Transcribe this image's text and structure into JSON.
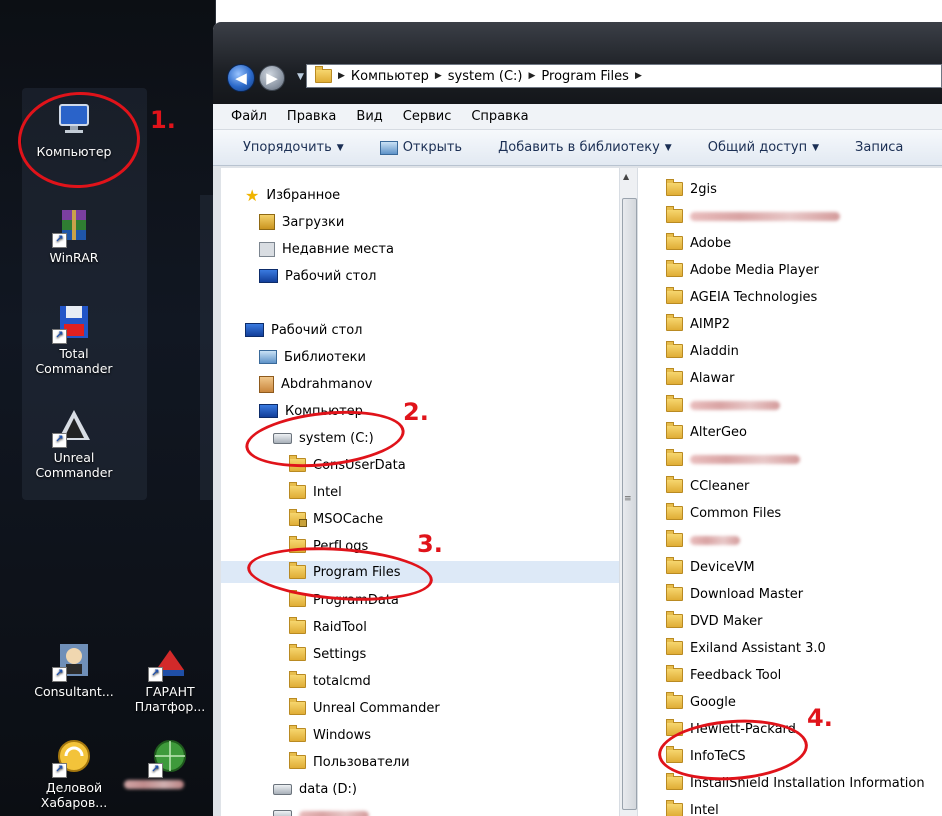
{
  "desktop": {
    "icons": [
      {
        "label": "Компьютер",
        "icon": "computer-icon"
      },
      {
        "label": "WinRAR",
        "icon": "winrar-icon"
      },
      {
        "label": "Total Commander",
        "icon": "total-commander-icon"
      },
      {
        "label": "Unreal Commander",
        "icon": "unreal-commander-icon"
      },
      {
        "label": "Consultant...",
        "icon": "consultant-icon"
      },
      {
        "label": "ГАРАНТ Платфор...",
        "icon": "garant-icon"
      },
      {
        "label": "Деловой Хабаров...",
        "icon": "delovoy-icon"
      }
    ]
  },
  "address": {
    "crumbs": [
      "Компьютер",
      "system (C:)",
      "Program Files"
    ]
  },
  "menu": [
    "Файл",
    "Правка",
    "Вид",
    "Сервис",
    "Справка"
  ],
  "toolbar": {
    "organize": "Упорядочить",
    "open": "Открыть",
    "add_library": "Добавить в библиотеку",
    "share": "Общий доступ",
    "burn": "Записа"
  },
  "nav_tree": [
    {
      "label": "Избранное",
      "icon": "star-icon"
    },
    {
      "label": "Загрузки",
      "icon": "downloads-icon"
    },
    {
      "label": "Недавние места",
      "icon": "recent-places-icon"
    },
    {
      "label": "Рабочий стол",
      "icon": "desktop-icon"
    },
    {
      "label": "Рабочий стол",
      "icon": "desktop-icon"
    },
    {
      "label": "Библиотеки",
      "icon": "libraries-icon"
    },
    {
      "label": "Abdrahmanov",
      "icon": "user-icon"
    },
    {
      "label": "Компьютер",
      "icon": "computer-icon"
    },
    {
      "label": "system (C:)",
      "icon": "drive-icon"
    },
    {
      "label": "ConsUserData",
      "icon": "folder-icon"
    },
    {
      "label": "Intel",
      "icon": "folder-icon"
    },
    {
      "label": "MSOCache",
      "icon": "locked-folder-icon"
    },
    {
      "label": "PerfLogs",
      "icon": "folder-icon"
    },
    {
      "label": "Program Files",
      "icon": "folder-icon"
    },
    {
      "label": "ProgramData",
      "icon": "folder-icon"
    },
    {
      "label": "RaidTool",
      "icon": "folder-icon"
    },
    {
      "label": "Settings",
      "icon": "folder-icon"
    },
    {
      "label": "totalcmd",
      "icon": "folder-icon"
    },
    {
      "label": "Unreal Commander",
      "icon": "folder-icon"
    },
    {
      "label": "Windows",
      "icon": "folder-icon"
    },
    {
      "label": "Пользователи",
      "icon": "folder-icon"
    },
    {
      "label": "data (D:)",
      "icon": "drive-icon"
    }
  ],
  "files": [
    {
      "label": "2gis"
    },
    {
      "label": ""
    },
    {
      "label": "Adobe"
    },
    {
      "label": "Adobe Media Player"
    },
    {
      "label": "AGEIA Technologies"
    },
    {
      "label": "AIMP2"
    },
    {
      "label": "Aladdin"
    },
    {
      "label": "Alawar"
    },
    {
      "label": ""
    },
    {
      "label": "AlterGeo"
    },
    {
      "label": ""
    },
    {
      "label": "CCleaner"
    },
    {
      "label": "Common Files"
    },
    {
      "label": ""
    },
    {
      "label": "DeviceVM"
    },
    {
      "label": "Download Master"
    },
    {
      "label": "DVD Maker"
    },
    {
      "label": "Exiland Assistant 3.0"
    },
    {
      "label": "Feedback Tool"
    },
    {
      "label": "Google"
    },
    {
      "label": "Hewlett-Packard"
    },
    {
      "label": "InfoTeCS"
    },
    {
      "label": "InstallShield Installation Information"
    },
    {
      "label": "Intel"
    }
  ],
  "annotations": [
    "1.",
    "2.",
    "3.",
    "4."
  ],
  "colors": {
    "annotation": "#e0131a",
    "folder": "#e0ad36",
    "selection": "#dde9f7"
  }
}
